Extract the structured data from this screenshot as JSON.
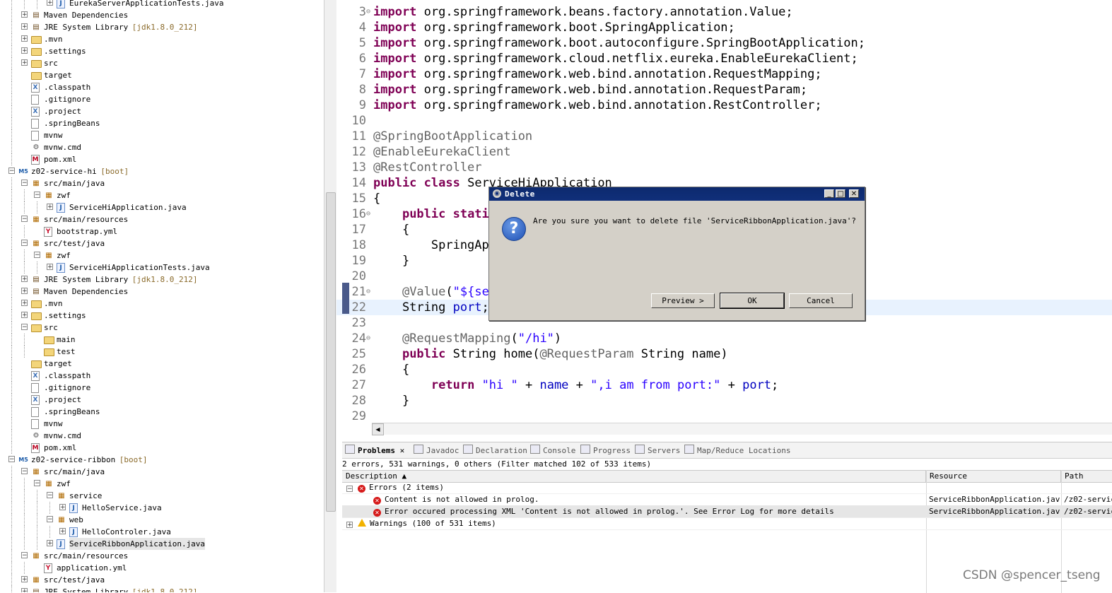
{
  "tree": {
    "rows": [
      {
        "d": 3,
        "tog": "+",
        "icon": "java",
        "label": "EurekaServerApplicationTests.java"
      },
      {
        "d": 1,
        "tog": "+",
        "icon": "jar",
        "label": "Maven Dependencies"
      },
      {
        "d": 1,
        "tog": "+",
        "icon": "jar",
        "label": "JRE System Library",
        "deco": "[jdk1.8.0_212]"
      },
      {
        "d": 1,
        "tog": "+",
        "icon": "folder",
        "label": ".mvn"
      },
      {
        "d": 1,
        "tog": "+",
        "icon": "folder",
        "label": ".settings"
      },
      {
        "d": 1,
        "tog": "+",
        "icon": "folder",
        "label": "src"
      },
      {
        "d": 1,
        "tog": "",
        "icon": "folder",
        "label": "target"
      },
      {
        "d": 1,
        "tog": "",
        "icon": "x",
        "label": ".classpath"
      },
      {
        "d": 1,
        "tog": "",
        "icon": "file",
        "label": ".gitignore"
      },
      {
        "d": 1,
        "tog": "",
        "icon": "x",
        "label": ".project"
      },
      {
        "d": 1,
        "tog": "",
        "icon": "file",
        "label": ".springBeans"
      },
      {
        "d": 1,
        "tog": "",
        "icon": "file",
        "label": "mvnw"
      },
      {
        "d": 1,
        "tog": "",
        "icon": "gear",
        "label": "mvnw.cmd"
      },
      {
        "d": 1,
        "tog": "",
        "icon": "m",
        "label": "pom.xml"
      },
      {
        "d": 0,
        "tog": "-",
        "icon": "proj",
        "label": "z02-service-hi",
        "deco": "[boot]"
      },
      {
        "d": 1,
        "tog": "-",
        "icon": "pkg",
        "label": "src/main/java"
      },
      {
        "d": 2,
        "tog": "-",
        "icon": "pkg",
        "label": "zwf"
      },
      {
        "d": 3,
        "tog": "+",
        "icon": "java",
        "label": "ServiceHiApplication.java"
      },
      {
        "d": 1,
        "tog": "-",
        "icon": "pkg",
        "label": "src/main/resources"
      },
      {
        "d": 2,
        "tog": "",
        "icon": "y",
        "label": "bootstrap.yml"
      },
      {
        "d": 1,
        "tog": "-",
        "icon": "pkg",
        "label": "src/test/java"
      },
      {
        "d": 2,
        "tog": "-",
        "icon": "pkg",
        "label": "zwf"
      },
      {
        "d": 3,
        "tog": "+",
        "icon": "java",
        "label": "ServiceHiApplicationTests.java"
      },
      {
        "d": 1,
        "tog": "+",
        "icon": "jar",
        "label": "JRE System Library",
        "deco": "[jdk1.8.0_212]"
      },
      {
        "d": 1,
        "tog": "+",
        "icon": "jar",
        "label": "Maven Dependencies"
      },
      {
        "d": 1,
        "tog": "+",
        "icon": "folder",
        "label": ".mvn"
      },
      {
        "d": 1,
        "tog": "+",
        "icon": "folder",
        "label": ".settings"
      },
      {
        "d": 1,
        "tog": "-",
        "icon": "folder",
        "label": "src"
      },
      {
        "d": 2,
        "tog": "",
        "icon": "folder",
        "label": "main"
      },
      {
        "d": 2,
        "tog": "",
        "icon": "folder",
        "label": "test"
      },
      {
        "d": 1,
        "tog": "",
        "icon": "folder",
        "label": "target"
      },
      {
        "d": 1,
        "tog": "",
        "icon": "x",
        "label": ".classpath"
      },
      {
        "d": 1,
        "tog": "",
        "icon": "file",
        "label": ".gitignore"
      },
      {
        "d": 1,
        "tog": "",
        "icon": "x",
        "label": ".project"
      },
      {
        "d": 1,
        "tog": "",
        "icon": "file",
        "label": ".springBeans"
      },
      {
        "d": 1,
        "tog": "",
        "icon": "file",
        "label": "mvnw"
      },
      {
        "d": 1,
        "tog": "",
        "icon": "gear",
        "label": "mvnw.cmd"
      },
      {
        "d": 1,
        "tog": "",
        "icon": "m",
        "label": "pom.xml"
      },
      {
        "d": 0,
        "tog": "-",
        "icon": "proj",
        "label": "z02-service-ribbon",
        "deco": "[boot]"
      },
      {
        "d": 1,
        "tog": "-",
        "icon": "pkg",
        "label": "src/main/java"
      },
      {
        "d": 2,
        "tog": "-",
        "icon": "pkg",
        "label": "zwf"
      },
      {
        "d": 3,
        "tog": "-",
        "icon": "pkg",
        "label": "service"
      },
      {
        "d": 4,
        "tog": "+",
        "icon": "java",
        "label": "HelloService.java"
      },
      {
        "d": 3,
        "tog": "-",
        "icon": "pkg",
        "label": "web"
      },
      {
        "d": 4,
        "tog": "+",
        "icon": "java",
        "label": "HelloControler.java"
      },
      {
        "d": 3,
        "tog": "+",
        "icon": "java",
        "label": "ServiceRibbonApplication.java",
        "selected": true
      },
      {
        "d": 1,
        "tog": "-",
        "icon": "pkg",
        "label": "src/main/resources"
      },
      {
        "d": 2,
        "tog": "",
        "icon": "y",
        "label": "application.yml"
      },
      {
        "d": 1,
        "tog": "+",
        "icon": "pkg",
        "label": "src/test/java"
      },
      {
        "d": 1,
        "tog": "+",
        "icon": "jar",
        "label": "JRE System Library",
        "deco": "[jdk1.8.0_212]"
      }
    ]
  },
  "editor": {
    "lines": [
      {
        "n": "3",
        "fold": "⊖",
        "parts": [
          [
            "kw",
            "import"
          ],
          [
            "",
            "org.springframework.beans.factory.annotation.Value;"
          ]
        ]
      },
      {
        "n": "4",
        "parts": [
          [
            "kw",
            "import"
          ],
          [
            "",
            "org.springframework.boot.SpringApplication;"
          ]
        ]
      },
      {
        "n": "5",
        "parts": [
          [
            "kw",
            "import"
          ],
          [
            "",
            "org.springframework.boot.autoconfigure.SpringBootApplication;"
          ]
        ]
      },
      {
        "n": "6",
        "parts": [
          [
            "kw",
            "import"
          ],
          [
            "",
            "org.springframework.cloud.netflix.eureka.EnableEurekaClient;"
          ]
        ]
      },
      {
        "n": "7",
        "parts": [
          [
            "kw",
            "import"
          ],
          [
            "",
            "org.springframework.web.bind.annotation.RequestMapping;"
          ]
        ]
      },
      {
        "n": "8",
        "parts": [
          [
            "kw",
            "import"
          ],
          [
            "",
            "org.springframework.web.bind.annotation.RequestParam;"
          ]
        ]
      },
      {
        "n": "9",
        "parts": [
          [
            "kw",
            "import"
          ],
          [
            "",
            "org.springframework.web.bind.annotation.RestController;"
          ]
        ]
      },
      {
        "n": "10",
        "parts": []
      },
      {
        "n": "11",
        "parts": [
          [
            "an",
            "@SpringBootApplication"
          ]
        ]
      },
      {
        "n": "12",
        "parts": [
          [
            "an",
            "@EnableEurekaClient"
          ]
        ]
      },
      {
        "n": "13",
        "parts": [
          [
            "an",
            "@RestController"
          ]
        ]
      },
      {
        "n": "14",
        "parts": [
          [
            "kw",
            "public"
          ],
          [
            "",
            " "
          ],
          [
            "kw",
            "class"
          ],
          [
            "",
            " ServiceHiApplication"
          ]
        ]
      },
      {
        "n": "15",
        "parts": [
          [
            "",
            "{"
          ]
        ]
      },
      {
        "n": "16",
        "fold": "⊖",
        "parts": [
          [
            "",
            "    "
          ],
          [
            "kw",
            "public static"
          ]
        ]
      },
      {
        "n": "17",
        "parts": [
          [
            "",
            "    {"
          ]
        ]
      },
      {
        "n": "18",
        "parts": [
          [
            "",
            "        SpringApp"
          ]
        ]
      },
      {
        "n": "19",
        "parts": [
          [
            "",
            "    }"
          ]
        ]
      },
      {
        "n": "20",
        "parts": []
      },
      {
        "n": "21",
        "fold": "⊖",
        "parts": [
          [
            "",
            "    "
          ],
          [
            "an",
            "@Value"
          ],
          [
            "",
            "("
          ],
          [
            "st",
            "\"${ser"
          ]
        ]
      },
      {
        "n": "22",
        "hl": true,
        "parts": [
          [
            "",
            "    String "
          ],
          [
            "fd",
            "port"
          ],
          [
            "",
            ";"
          ]
        ]
      },
      {
        "n": "23",
        "parts": []
      },
      {
        "n": "24",
        "fold": "⊖",
        "parts": [
          [
            "",
            "    "
          ],
          [
            "an",
            "@RequestMapping"
          ],
          [
            "",
            "("
          ],
          [
            "st",
            "\"/hi\""
          ],
          [
            "",
            ")"
          ]
        ]
      },
      {
        "n": "25",
        "parts": [
          [
            "",
            "    "
          ],
          [
            "kw",
            "public"
          ],
          [
            "",
            " String home("
          ],
          [
            "an",
            "@RequestParam"
          ],
          [
            "",
            " String name)"
          ]
        ]
      },
      {
        "n": "26",
        "parts": [
          [
            "",
            "    {"
          ]
        ]
      },
      {
        "n": "27",
        "parts": [
          [
            "",
            "        "
          ],
          [
            "kw",
            "return"
          ],
          [
            "",
            " "
          ],
          [
            "st",
            "\"hi \""
          ],
          [
            "",
            " + "
          ],
          [
            "fd",
            "name"
          ],
          [
            "",
            " + "
          ],
          [
            "st",
            "\",i am from port:\""
          ],
          [
            "",
            " + "
          ],
          [
            "fd",
            "port"
          ],
          [
            "",
            ";"
          ]
        ]
      },
      {
        "n": "28",
        "parts": [
          [
            "",
            "    }"
          ]
        ]
      },
      {
        "n": "29",
        "parts": []
      }
    ]
  },
  "problems": {
    "tabs": [
      {
        "label": "Problems",
        "active": true
      },
      {
        "label": "Javadoc"
      },
      {
        "label": "Declaration"
      },
      {
        "label": "Console"
      },
      {
        "label": "Progress"
      },
      {
        "label": "Servers"
      },
      {
        "label": "Map/Reduce Locations"
      }
    ],
    "summary": "2 errors, 531 warnings, 0 others (Filter matched 102 of 533 items)",
    "columns": {
      "description": "Description",
      "resource": "Resource",
      "path": "Path"
    },
    "rows": [
      {
        "kind": "group-error",
        "tog": "-",
        "desc": "Errors (2 items)",
        "resource": "",
        "path": ""
      },
      {
        "kind": "error",
        "desc": "Content is not allowed in prolog.",
        "resource": "ServiceRibbonApplication.java",
        "path": "/z02-servic"
      },
      {
        "kind": "error",
        "desc": "Error occured processing XML 'Content is not allowed in prolog.'. See Error Log for more details",
        "resource": "ServiceRibbonApplication.java",
        "path": "/z02-servic",
        "selected": true
      },
      {
        "kind": "group-warning",
        "tog": "+",
        "desc": "Warnings (100 of 531 items)",
        "resource": "",
        "path": ""
      }
    ]
  },
  "dialog": {
    "title": "Delete",
    "message": "Are you sure you want to delete file 'ServiceRibbonApplication.java'?",
    "preview_label": "Preview >",
    "ok_label": "OK",
    "cancel_label": "Cancel"
  },
  "watermark": "CSDN @spencer_tseng"
}
